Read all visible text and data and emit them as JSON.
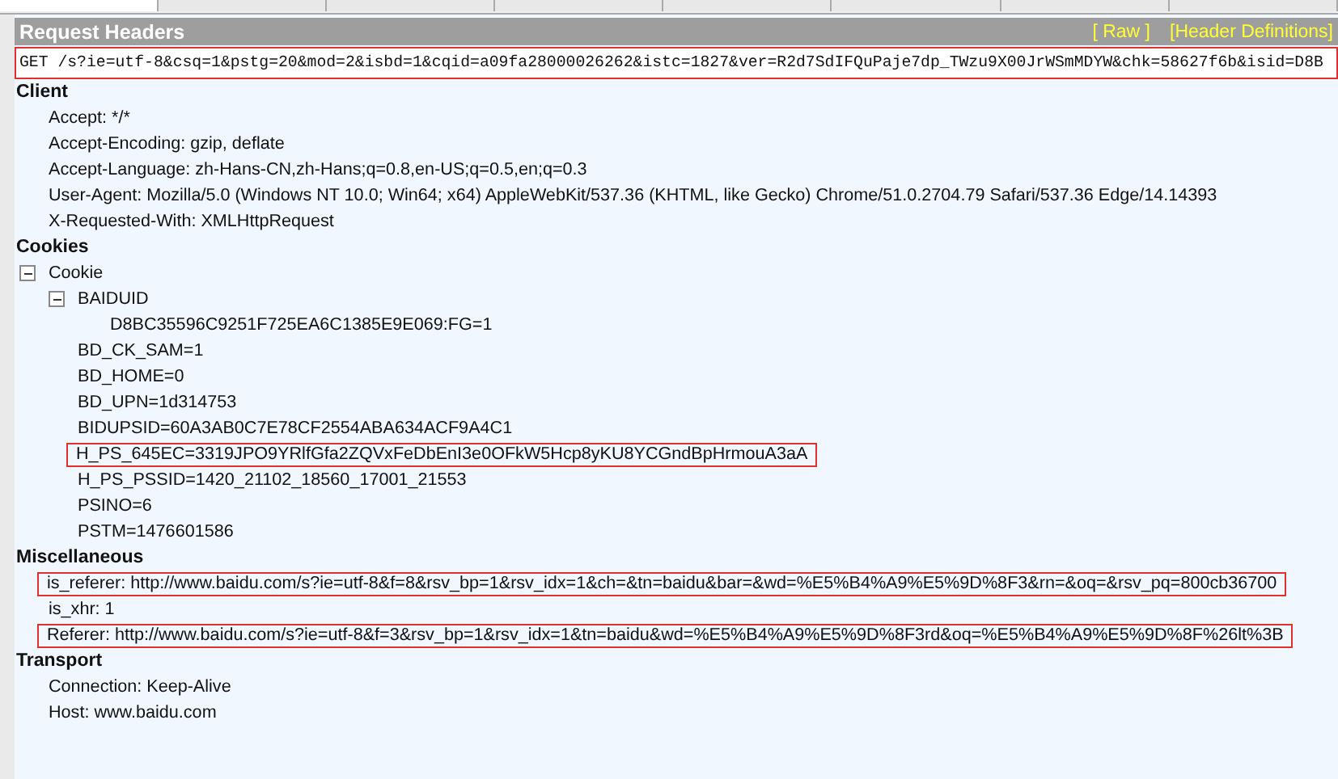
{
  "tabs": [
    {
      "selected": true
    },
    {
      "selected": false
    },
    {
      "selected": false
    },
    {
      "selected": false
    },
    {
      "selected": false
    },
    {
      "selected": false
    },
    {
      "selected": false
    },
    {
      "selected": false
    }
  ],
  "panel": {
    "title": "Request Headers",
    "links": [
      "[ Raw ]",
      "[Header Definitions]"
    ]
  },
  "request_line": {
    "text": "GET /s?ie=utf-8&csq=1&pstg=20&mod=2&isbd=1&cqid=a09fa28000026262&istc=1827&ver=R2d7SdIFQuPaje7dp_TWzu9X00JrWSmMDYW&chk=58627f6b&isid=D8B",
    "highlighted": true
  },
  "groups": [
    {
      "name": "Client",
      "items": [
        {
          "text": "Accept: */*",
          "highlighted": false
        },
        {
          "text": "Accept-Encoding: gzip, deflate",
          "highlighted": false
        },
        {
          "text": "Accept-Language: zh-Hans-CN,zh-Hans;q=0.8,en-US;q=0.5,en;q=0.3",
          "highlighted": false
        },
        {
          "text": "User-Agent: Mozilla/5.0 (Windows NT 10.0; Win64; x64) AppleWebKit/537.36 (KHTML, like Gecko) Chrome/51.0.2704.79 Safari/537.36 Edge/14.14393",
          "highlighted": false
        },
        {
          "text": "X-Requested-With: XMLHttpRequest",
          "highlighted": false
        }
      ]
    },
    {
      "name": "Cookies",
      "items": [
        {
          "text": "Cookie",
          "highlighted": false,
          "expanded": true,
          "children": [
            {
              "text": "BAIDUID",
              "highlighted": false,
              "expanded": true,
              "children": [
                {
                  "text": "D8BC35596C9251F725EA6C1385E9E069:FG=1",
                  "highlighted": false
                }
              ]
            },
            {
              "text": "BD_CK_SAM=1",
              "highlighted": false
            },
            {
              "text": "BD_HOME=0",
              "highlighted": false
            },
            {
              "text": "BD_UPN=1d314753",
              "highlighted": false
            },
            {
              "text": "BIDUPSID=60A3AB0C7E78CF2554ABA634ACF9A4C1",
              "highlighted": false
            },
            {
              "text": "H_PS_645EC=3319JPO9YRlfGfa2ZQVxFeDbEnI3e0OFkW5Hcp8yKU8YCGndBpHrmouA3aA",
              "highlighted": true
            },
            {
              "text": "H_PS_PSSID=1420_21102_18560_17001_21553",
              "highlighted": false
            },
            {
              "text": "PSINO=6",
              "highlighted": false
            },
            {
              "text": "PSTM=1476601586",
              "highlighted": false
            }
          ]
        }
      ]
    },
    {
      "name": "Miscellaneous",
      "items": [
        {
          "text": "is_referer: http://www.baidu.com/s?ie=utf-8&f=8&rsv_bp=1&rsv_idx=1&ch=&tn=baidu&bar=&wd=%E5%B4%A9%E5%9D%8F3&rn=&oq=&rsv_pq=800cb36700",
          "highlighted": true
        },
        {
          "text": "is_xhr: 1",
          "highlighted": false
        },
        {
          "text": "Referer: http://www.baidu.com/s?ie=utf-8&f=3&rsv_bp=1&rsv_idx=1&tn=baidu&wd=%E5%B4%A9%E5%9D%8F3rd&oq=%E5%B4%A9%E5%9D%8F%26lt%3B",
          "highlighted": true
        }
      ]
    },
    {
      "name": "Transport",
      "items": [
        {
          "text": "Connection: Keep-Alive",
          "highlighted": false
        },
        {
          "text": "Host: www.baidu.com",
          "highlighted": false
        }
      ]
    }
  ]
}
